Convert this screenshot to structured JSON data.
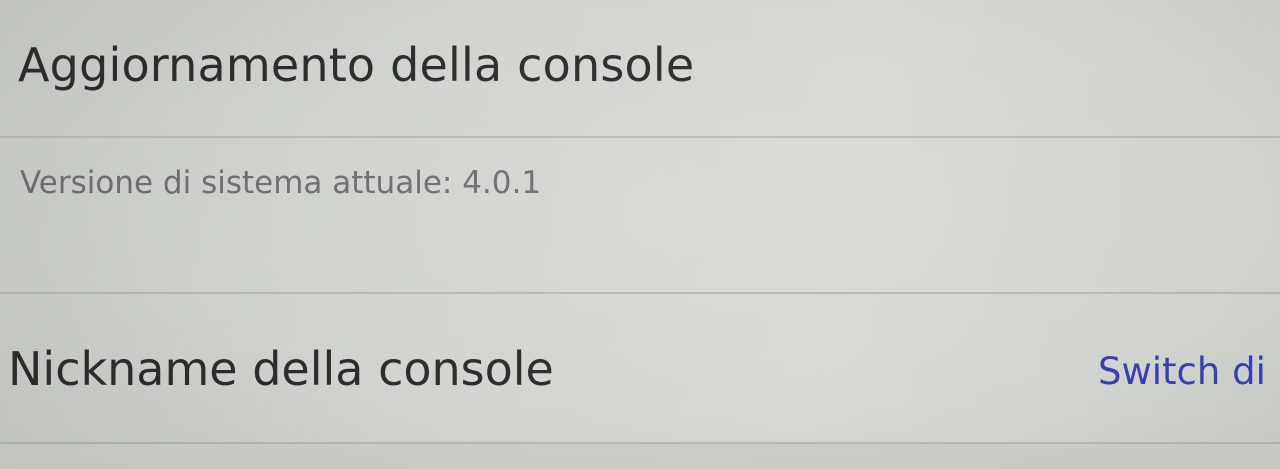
{
  "settings": {
    "system_update": {
      "title": "Aggiornamento della console",
      "version_text": "Versione di sistema attuale: 4.0.1"
    },
    "console_nickname": {
      "label": "Nickname della console",
      "value": "Switch di"
    }
  },
  "colors": {
    "background": "#d2d5cf",
    "primary_text": "#2b2d2e",
    "secondary_text": "#6c6e6c",
    "accent_value": "#3a3fb6",
    "divider": "#b6b9b3"
  }
}
